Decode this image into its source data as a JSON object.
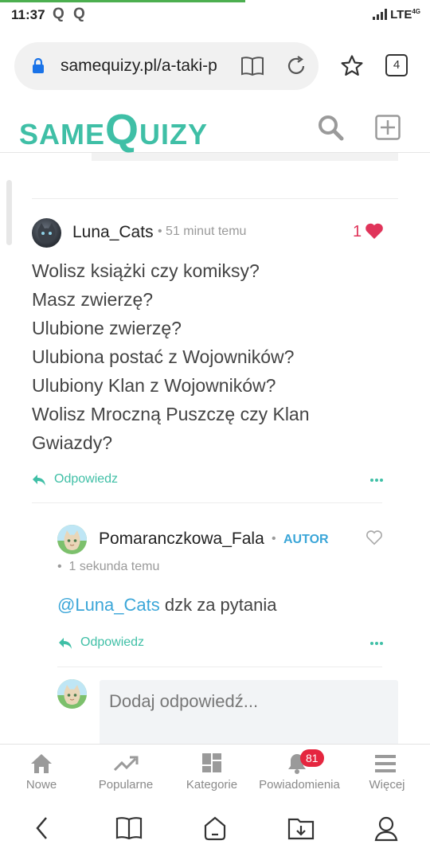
{
  "status_bar": {
    "time": "11:37",
    "q_icons": [
      "Q",
      "Q"
    ],
    "network": "LTE",
    "network_sub": "4G"
  },
  "browser": {
    "url": "samequizy.pl/a-taki-p",
    "tab_count": "4",
    "icons": [
      "lock-icon",
      "reader-mode-icon",
      "refresh-icon",
      "star-icon",
      "tabs-icon"
    ]
  },
  "site": {
    "logo_part1": "SAME",
    "logo_part2": "Q",
    "logo_part3": "UIZY",
    "brand_color": "#3fbfa6",
    "icons": [
      "search-icon",
      "plus-icon"
    ]
  },
  "comment": {
    "username": "Luna_Cats",
    "timestamp": "51 minut temu",
    "like_count": "1",
    "liked": true,
    "lines": [
      "Wolisz książki czy komiksy?",
      "Masz zwierzę?",
      "Ulubione zwierzę?",
      "Ulubiona postać z Wojowników?",
      "Ulubiony Klan z Wojowników?",
      "Wolisz Mroczną Puszczę czy Klan",
      "Gwiazdy?"
    ],
    "reply_label": "Odpowiedz"
  },
  "reply": {
    "username": "Pomaranczkowa_Fala",
    "author_badge": "AUTOR",
    "timestamp": "1 sekunda temu",
    "mention": "@Luna_Cats",
    "text": " dzk za pytania",
    "reply_label": "Odpowiedz",
    "liked": false
  },
  "reply_box": {
    "placeholder": "Dodaj odpowiedź..."
  },
  "bottom_nav": {
    "items": [
      {
        "label": "Nowe",
        "icon": "home-icon"
      },
      {
        "label": "Popularne",
        "icon": "trending-icon"
      },
      {
        "label": "Kategorie",
        "icon": "grid-icon"
      },
      {
        "label": "Powiadomienia",
        "icon": "bell-icon",
        "badge": "81"
      },
      {
        "label": "Więcej",
        "icon": "menu-icon"
      }
    ]
  },
  "android_nav": {
    "icons": [
      "back-icon",
      "book-icon",
      "home-icon",
      "download-icon",
      "profile-icon"
    ]
  },
  "colors": {
    "accent": "#3fbfa6",
    "like": "#e0345a",
    "author": "#3ba6d8",
    "badge": "#e5263f"
  }
}
